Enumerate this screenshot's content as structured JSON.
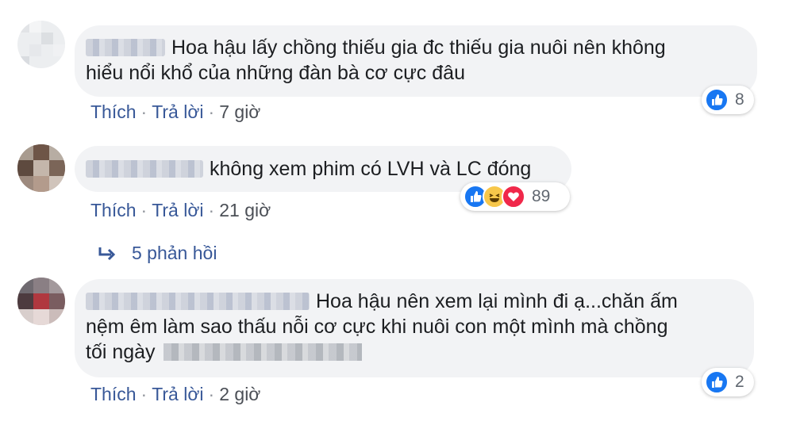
{
  "comments": [
    {
      "text_line1": "Hoa hậu lấy chồng thiếu gia đc thiếu gia nuôi nên không",
      "text_line2": "hiểu nổi khổ của những đàn bà cơ cực đâu",
      "like_label": "Thích",
      "reply_label": "Trả lời",
      "time": "7 giờ",
      "reaction_count": "8"
    },
    {
      "text": "không xem phim có LVH và LC đóng",
      "like_label": "Thích",
      "reply_label": "Trả lời",
      "time": "21 giờ",
      "reaction_count": "89",
      "replies_label": "5 phản hồi"
    },
    {
      "text_line1": "Hoa hậu nên xem lại mình đi ạ...chăn ấm",
      "text_line2": "nệm êm làm sao thấu nỗi cơ cực khi nuôi con một mình mà chồng",
      "text_line3": "tối ngày",
      "like_label": "Thích",
      "reply_label": "Trả lời",
      "time": "2 giờ",
      "reaction_count": "2"
    }
  ],
  "colors": {
    "link": "#385898",
    "bubble": "#f2f3f5",
    "like_blue": "#1877f2",
    "haha_yellow": "#f7c74a",
    "love_red": "#f0284a"
  },
  "icons": [
    "like-icon",
    "haha-icon",
    "love-icon",
    "reply-arrow-icon"
  ]
}
